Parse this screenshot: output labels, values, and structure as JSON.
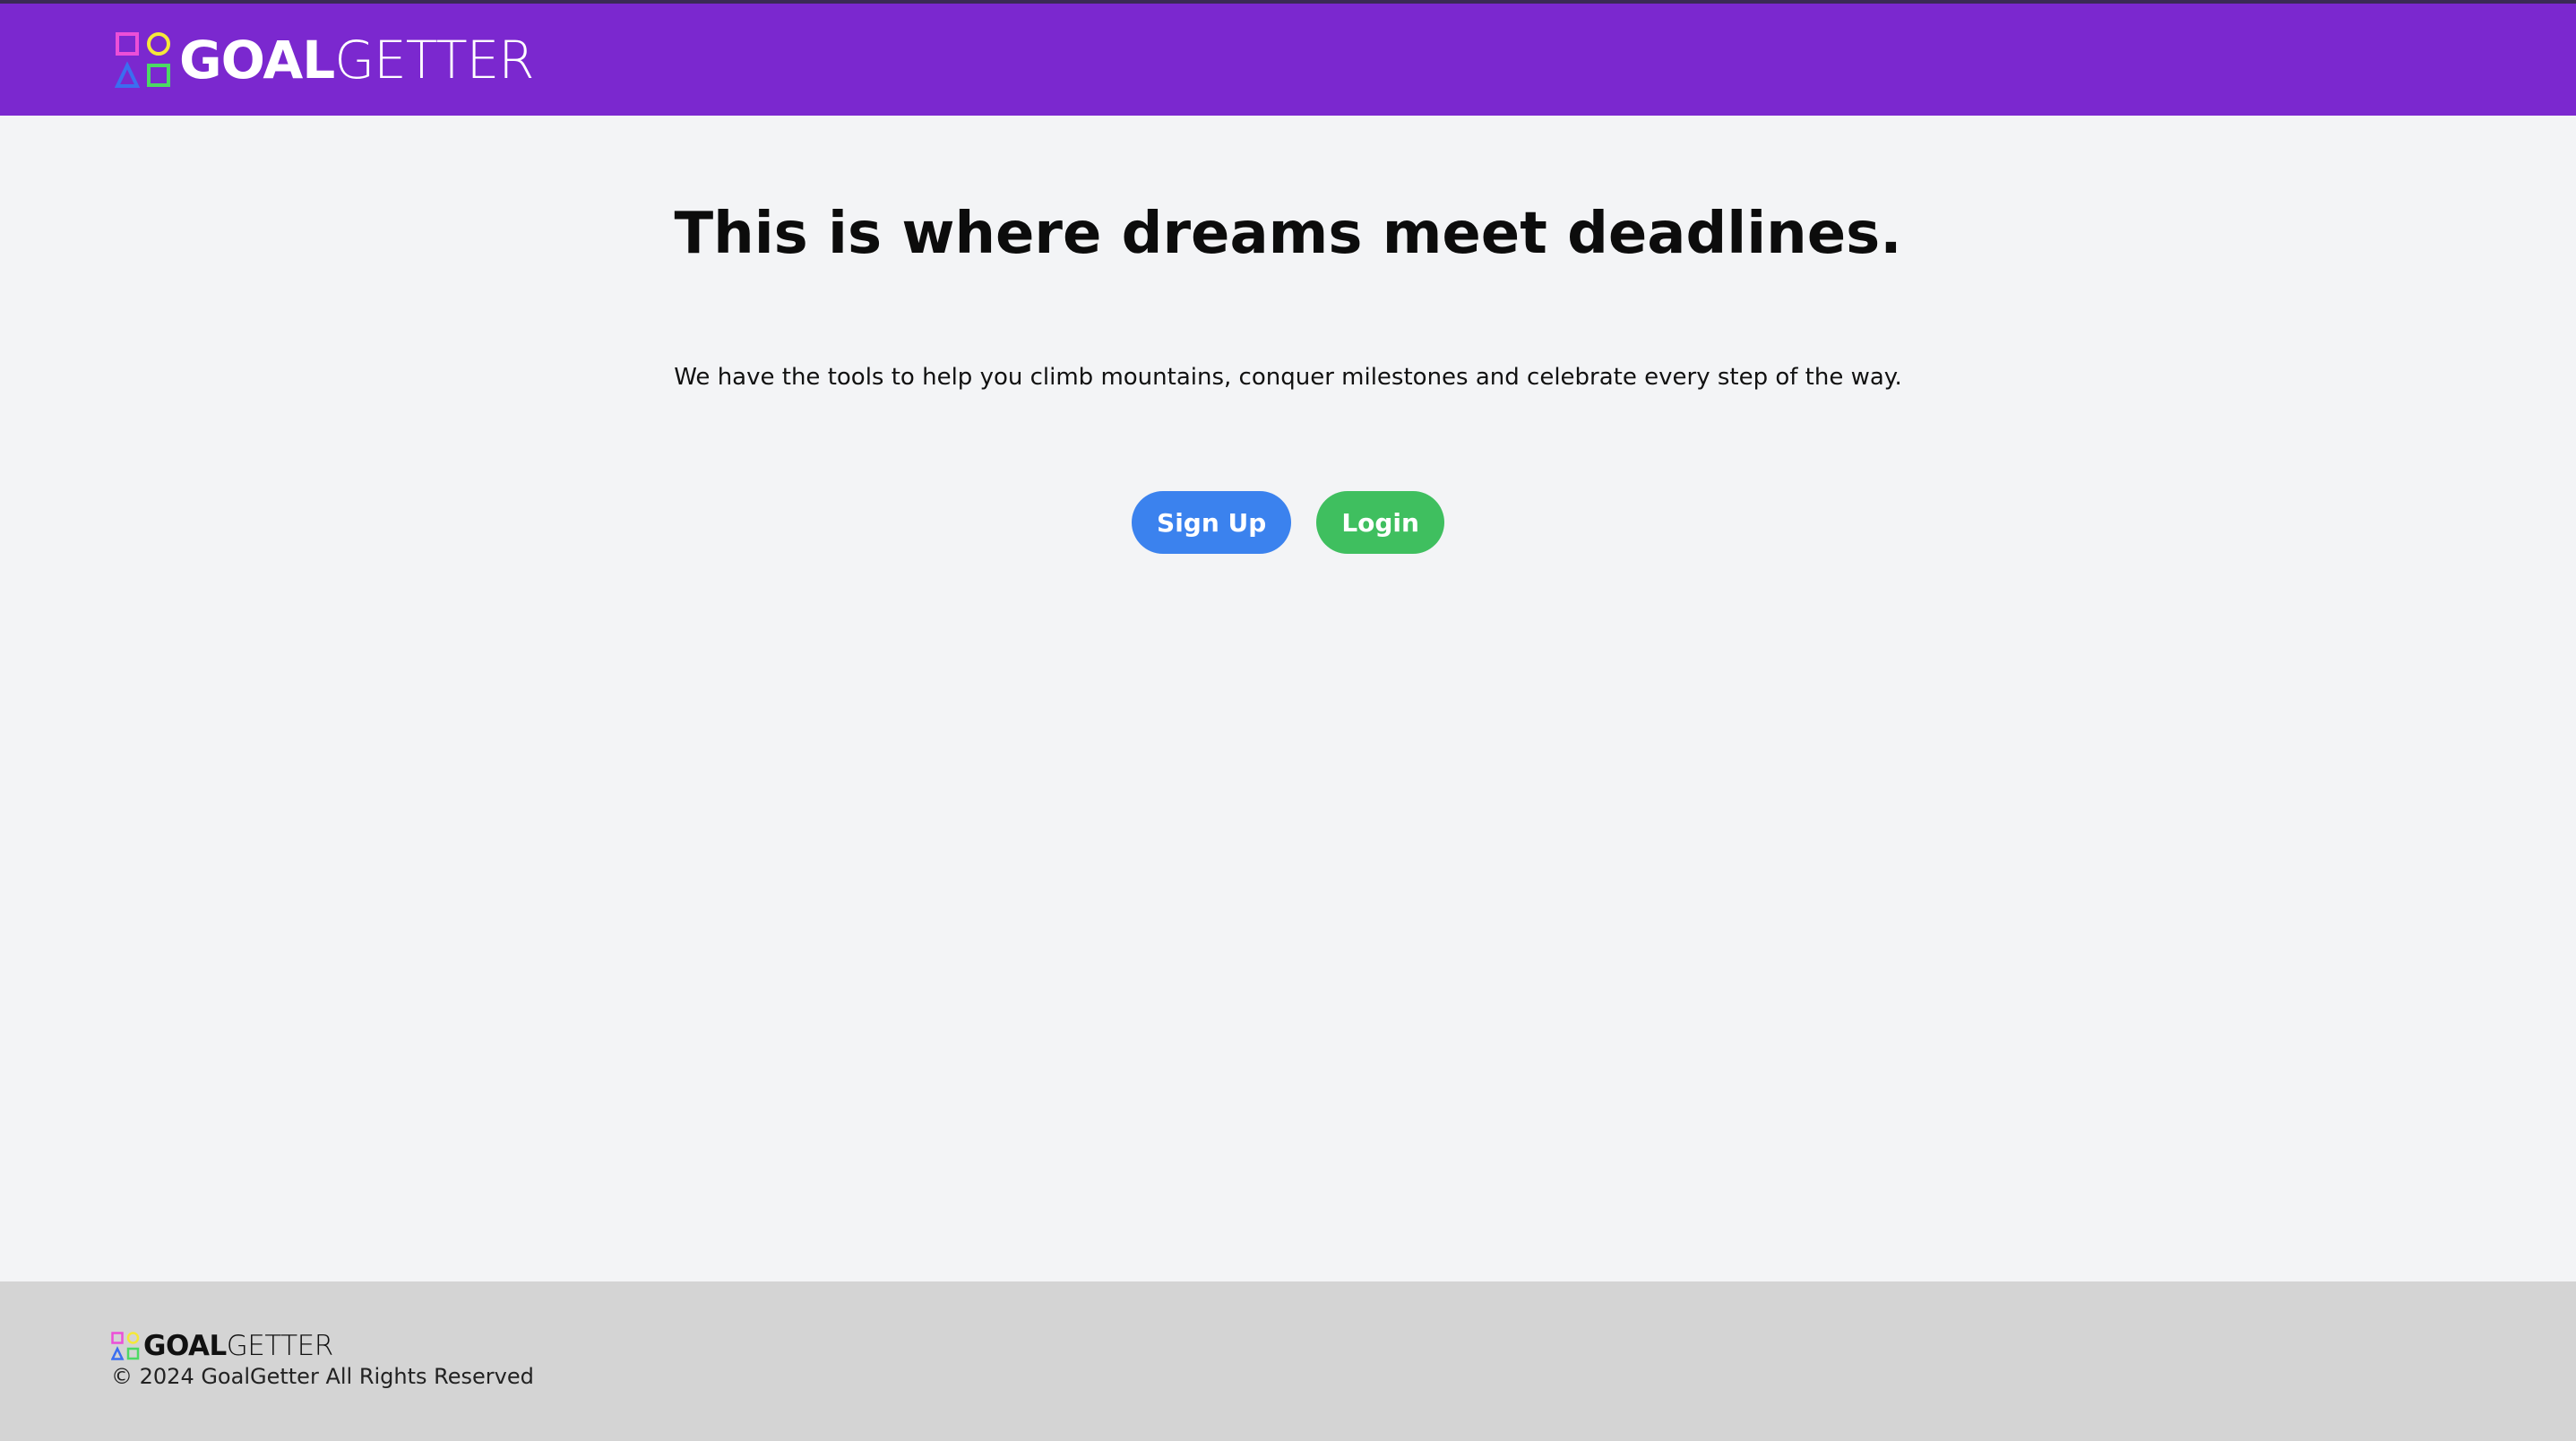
{
  "header": {
    "logo_bold": "GOAL",
    "logo_light": "GETTER",
    "logo_colors": [
      "#ec4fd8",
      "#f5e83a",
      "#3b6ef0",
      "#4cd964"
    ]
  },
  "hero": {
    "title": "This is where dreams meet deadlines.",
    "subtitle": "We have the tools to help you climb mountains, conquer milestones and celebrate every step of the way."
  },
  "actions": {
    "signup_label": "Sign Up",
    "login_label": "Login"
  },
  "footer": {
    "logo_bold": "GOAL",
    "logo_light": "GETTER",
    "copyright": "© 2024 GoalGetter All Rights Reserved"
  },
  "colors": {
    "header_bg": "#7b28cf",
    "page_bg": "#f3f4f6",
    "footer_bg": "#d4d4d4",
    "signup_button": "#3b82ee",
    "login_button": "#3fbf5f"
  }
}
